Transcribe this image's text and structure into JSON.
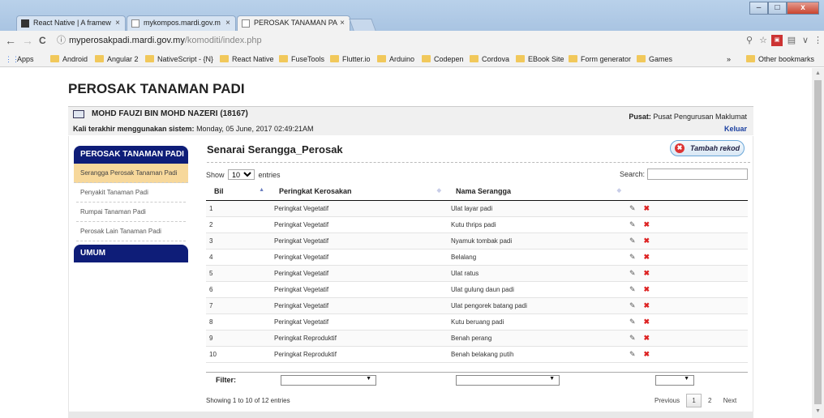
{
  "browser": {
    "tabs": [
      {
        "title": "React Native | A framew",
        "active": false
      },
      {
        "title": "mykompos.mardi.gov.m",
        "active": false
      },
      {
        "title": "PEROSAK TANAMAN PA",
        "active": true
      }
    ],
    "window_buttons": {
      "minimize": "–",
      "maximize": "□",
      "close": "x"
    },
    "nav": {
      "back": "←",
      "forward": "→",
      "reload": "C"
    },
    "address": {
      "host": "myperosakpadi.mardi.gov.my",
      "path": "/komoditi/index.php"
    },
    "bookmarks": [
      "Apps",
      "Android",
      "Angular 2",
      "NativeScript - {N}",
      "React Native",
      "FuseTools",
      "Flutter.io",
      "Arduino",
      "Codepen",
      "Cordova",
      "EBook Site",
      "Form generator",
      "Games"
    ],
    "bookmarks_more": "»",
    "other_bookmarks": "Other bookmarks"
  },
  "page": {
    "title": "PEROSAK TANAMAN PADI",
    "user_name": "MOHD FAUZI BIN MOHD NAZERI (18167)",
    "last_use_label": "Kali terakhir menggunakan sistem:",
    "last_use_value": "Monday, 05 June, 2017 02:49:21AM",
    "pusat_label": "Pusat:",
    "pusat_value": "Pusat Pengurusan Maklumat",
    "logout": "Keluar"
  },
  "sidebar": {
    "section1": "PEROSAK TANAMAN PADI",
    "items": [
      {
        "label": "Serangga Perosak Tanaman Padi",
        "active": true
      },
      {
        "label": "Penyakit Tanaman Padi",
        "active": false
      },
      {
        "label": "Rumpai Tanaman Padi",
        "active": false
      },
      {
        "label": "Perosak Lain Tanaman Padi",
        "active": false
      }
    ],
    "section2": "UMUM"
  },
  "main": {
    "title": "Senarai Serangga_Perosak",
    "add_button": "Tambah rekod",
    "show_label": "Show",
    "entries_label": "entries",
    "page_length": "10",
    "search_label": "Search:",
    "search_value": "",
    "columns": [
      "Bil",
      "Peringkat Kerosakan",
      "Nama Serangga",
      ""
    ],
    "rows": [
      [
        "1",
        "Peringkat Vegetatif",
        "Ulat layar padi"
      ],
      [
        "2",
        "Peringkat Vegetatif",
        "Kutu thrips padi"
      ],
      [
        "3",
        "Peringkat Vegetatif",
        "Nyamuk tombak padi"
      ],
      [
        "4",
        "Peringkat Vegetatif",
        "Belalang"
      ],
      [
        "5",
        "Peringkat Vegetatif",
        "Ulat ratus"
      ],
      [
        "6",
        "Peringkat Vegetatif",
        "Ulat gulung daun padi"
      ],
      [
        "7",
        "Peringkat Vegetatif",
        "Ulat pengorek batang padi"
      ],
      [
        "8",
        "Peringkat Vegetatif",
        "Kutu beruang padi"
      ],
      [
        "9",
        "Peringkat Reproduktif",
        "Benah perang"
      ],
      [
        "10",
        "Peringkat Reproduktif",
        "Benah belakang putih"
      ]
    ],
    "filter_label": "Filter:",
    "info": "Showing 1 to 10 of 12 entries",
    "pager": {
      "previous": "Previous",
      "pages": [
        "1",
        "2"
      ],
      "current": "1",
      "next": "Next"
    }
  },
  "colors": {
    "nav_head": "#0e1d78",
    "active_item": "#f7d89b",
    "logout": "#1a3fa0",
    "delete": "#dd2222"
  }
}
